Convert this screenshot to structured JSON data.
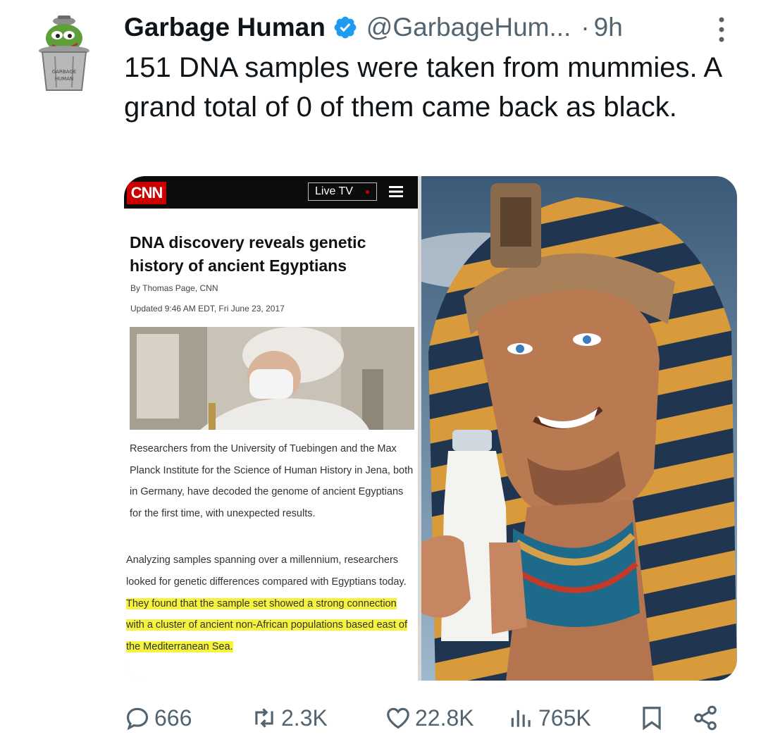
{
  "tweet": {
    "display_name": "Garbage Human",
    "handle": "@GarbageHum...",
    "separator": "·",
    "time": "9h",
    "text": "151 DNA samples were taken from mummies. A grand total of 0 of them came back as black.",
    "avatar_text": "GARBAGE HUMAN"
  },
  "article": {
    "logo": "CNN",
    "live_tv": "Live TV",
    "headline": "DNA discovery reveals genetic history of ancient Egyptians",
    "byline": "By Thomas Page, CNN",
    "updated": "Updated 9:46 AM EDT, Fri June 23, 2017",
    "paragraph1": "Researchers from the University of Tuebingen and the Max Planck Institute for the Science of Human History in Jena, both in Germany, have decoded the genome of ancient Egyptians for the first time, with unexpected results.",
    "paragraph2_plain": "Analyzing samples spanning over a millennium, researchers looked for genetic differences compared with Egyptians today.",
    "paragraph2_highlight": "They found that the sample set showed a strong connection with a cluster of ancient non-African populations based east of the Mediterranean Sea."
  },
  "actions": {
    "replies": "666",
    "retweets": "2.3K",
    "likes": "22.8K",
    "views": "765K"
  },
  "colors": {
    "verified": "#1d9bf0",
    "secondary_text": "#536471",
    "cnn_red": "#cc0000",
    "highlight": "#f5f33c"
  },
  "icons": [
    "pepe-avatar-icon",
    "verified-badge-icon",
    "more-options-icon",
    "cnn-menu-icon",
    "reply-icon",
    "retweet-icon",
    "like-icon",
    "views-icon",
    "bookmark-icon",
    "share-icon"
  ]
}
